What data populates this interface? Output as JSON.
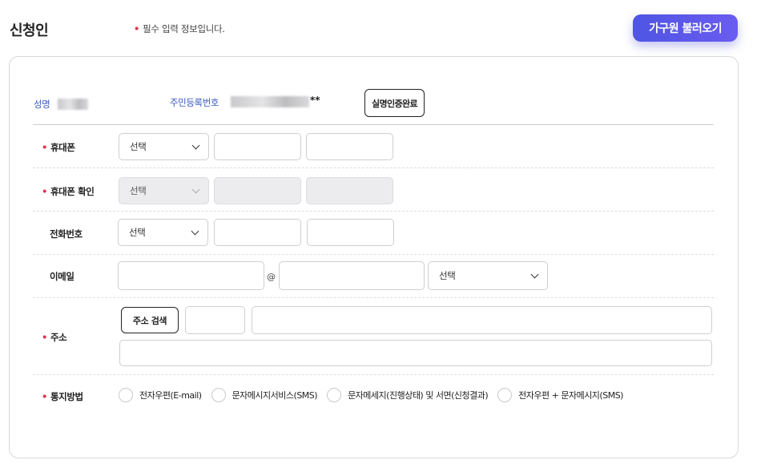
{
  "header": {
    "title": "신청인",
    "required_note": "필수 입력 정보입니다.",
    "load_family_button": "가구원 불러오기"
  },
  "applicant": {
    "name_label": "성명",
    "rrn_label": "주민등록번호",
    "rrn_masked_suffix": "**",
    "verify_button": "실명인증완료"
  },
  "form": {
    "mobile": {
      "label": "휴대폰",
      "select_value": "선택"
    },
    "mobile_confirm": {
      "label": "휴대폰 확인",
      "select_value": "선택"
    },
    "phone": {
      "label": "전화번호",
      "select_value": "선택"
    },
    "email": {
      "label": "이메일",
      "at_symbol": "@",
      "select_value": "선택"
    },
    "address": {
      "label": "주소",
      "search_button": "주소 검색"
    },
    "notification": {
      "label": "통지방법",
      "options": [
        "전자우편(E-mail)",
        "문자메시지서비스(SMS)",
        "문자메세지(진행상태) 및 서면(신청결과)",
        "전자우편 + 문자메시지(SMS)"
      ]
    }
  },
  "colors": {
    "accent_gradient_start": "#4f55e3",
    "accent_gradient_end": "#6a5cf0",
    "required_dot": "#e0314b",
    "info_label": "#3b5bbf"
  }
}
